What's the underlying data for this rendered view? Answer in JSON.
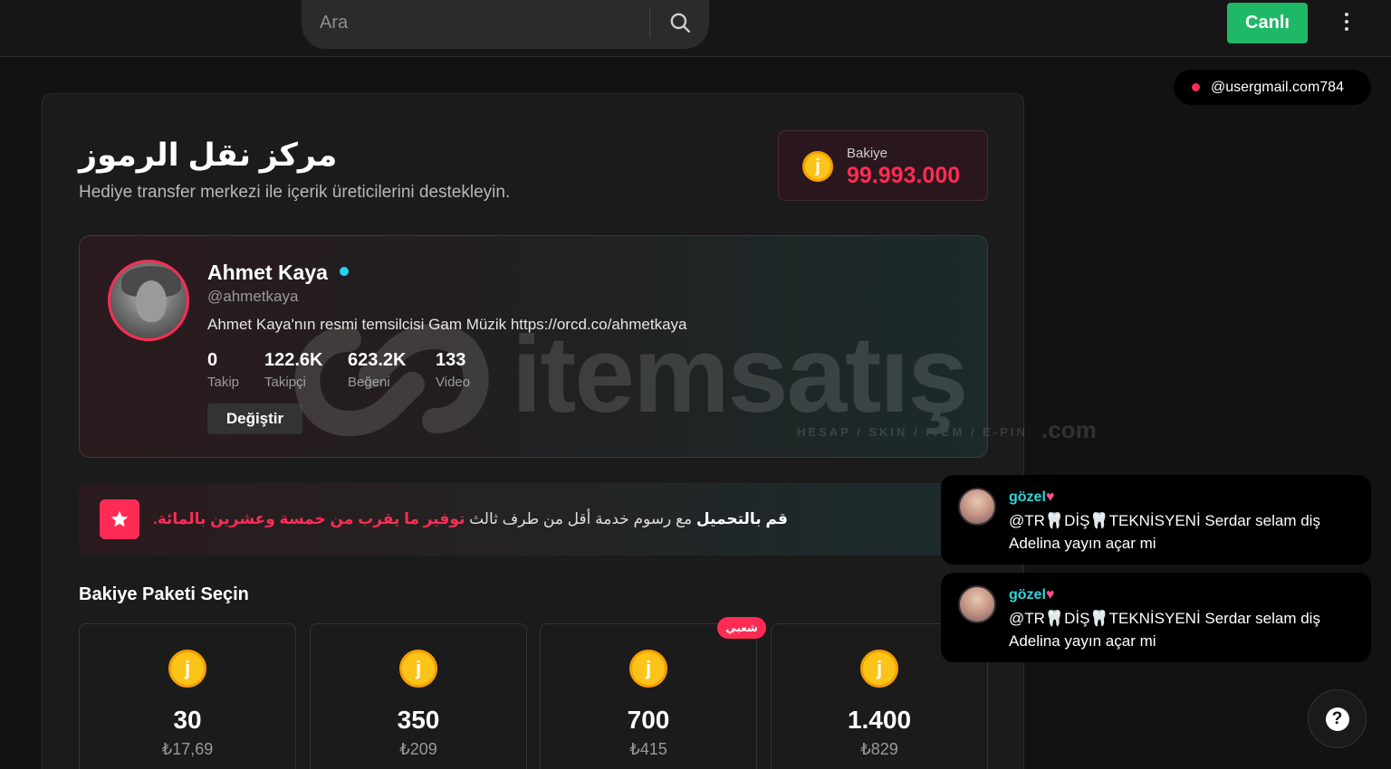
{
  "header": {
    "search_placeholder": "Ara",
    "live_label": "Canlı"
  },
  "user_pill": {
    "email": "@usergmail.com784"
  },
  "page": {
    "title": "مركز نقل الرموز",
    "subtitle": "Hediye transfer merkezi ile içerik üreticilerini destekleyin."
  },
  "balance": {
    "label": "Bakiye",
    "value": "99.993.000",
    "coin_symbol": "j"
  },
  "profile": {
    "name": "Ahmet Kaya",
    "handle": "@ahmetkaya",
    "bio": "Ahmet Kaya'nın resmi temsilcisi Gam Müzik https://orcd.co/ahmetkaya",
    "stats": [
      {
        "value": "0",
        "label": "Takip"
      },
      {
        "value": "122.6K",
        "label": "Takipçi"
      },
      {
        "value": "623.2K",
        "label": "Beğeni"
      },
      {
        "value": "133",
        "label": "Video"
      }
    ],
    "change_label": "Değiştir"
  },
  "watermark": {
    "brand": "itemsatış",
    "tagline": "HESAP / SKIN / ITEM / E-PIN",
    "domain": ".com"
  },
  "promo": {
    "bold": "قم بالتحميل",
    "middle": " مع رسوم خدمة أقل من طرف ثالث ",
    "highlight": "توفير ما يقرب من خمسة وعشرين بالمائة",
    "end": "."
  },
  "packages": {
    "title": "Bakiye Paketi Seçin",
    "badge": "شعبي",
    "items": [
      {
        "amount": "30",
        "price": "₺17,69"
      },
      {
        "amount": "350",
        "price": "₺209"
      },
      {
        "amount": "700",
        "price": "₺415"
      },
      {
        "amount": "1.400",
        "price": "₺829"
      }
    ]
  },
  "chat": [
    {
      "user": "gözel",
      "message": "@TR🦷DİŞ🦷TEKNİSYENİ Serdar selam diş Adelina yayın açar mi"
    },
    {
      "user": "gözel",
      "message": "@TR🦷DİŞ🦷TEKNİSYENİ Serdar selam diş Adelina yayın açar mi"
    }
  ],
  "colors": {
    "accent": "#fe2c55",
    "live": "#1fb867",
    "coin": "#fcc419",
    "chat_name": "#33d4d9"
  },
  "icons": {
    "search": "search-icon",
    "more": "more-vertical-icon",
    "star": "star-icon",
    "help": "help-icon",
    "verified": "verified-icon"
  }
}
